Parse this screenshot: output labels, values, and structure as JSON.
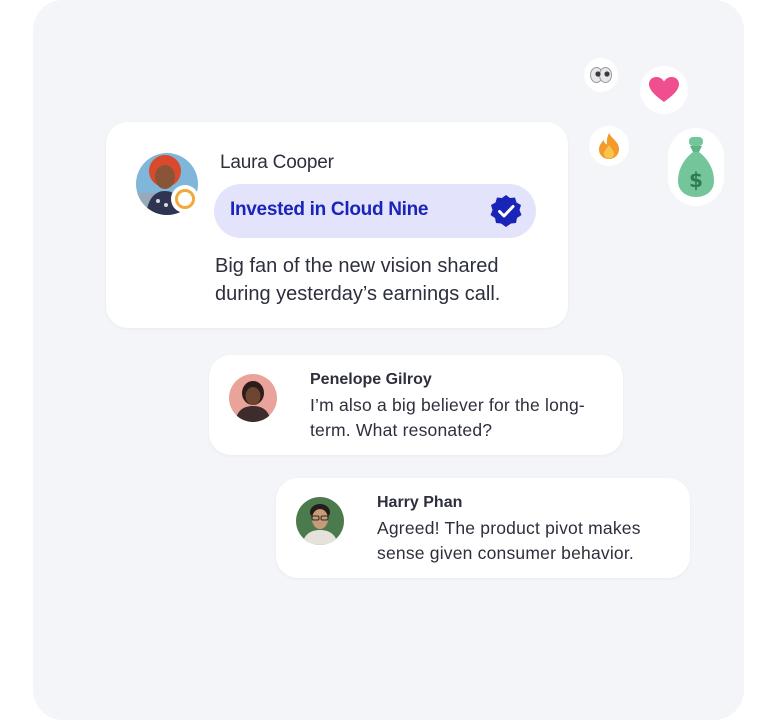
{
  "main_post": {
    "author": "Laura Cooper",
    "badge_text": "Invested in Cloud Nine",
    "message": "Big fan of the new vision shared during yesterday’s earnings call."
  },
  "replies": [
    {
      "author": "Penelope Gilroy",
      "message": "I’m also a big believer for the long-term. What resonated?"
    },
    {
      "author": "Harry Phan",
      "message": "Agreed! The product pivot makes sense given consumer behavior."
    }
  ],
  "reactions": [
    "eyes-icon",
    "heart-icon",
    "fire-icon",
    "money-bag-icon"
  ],
  "colors": {
    "panel_background": "#f4f5f8",
    "badge_background": "#e3e4fc",
    "badge_text": "#1b24b8",
    "heart": "#ef4f8e",
    "money_bag": "#74c59a"
  }
}
